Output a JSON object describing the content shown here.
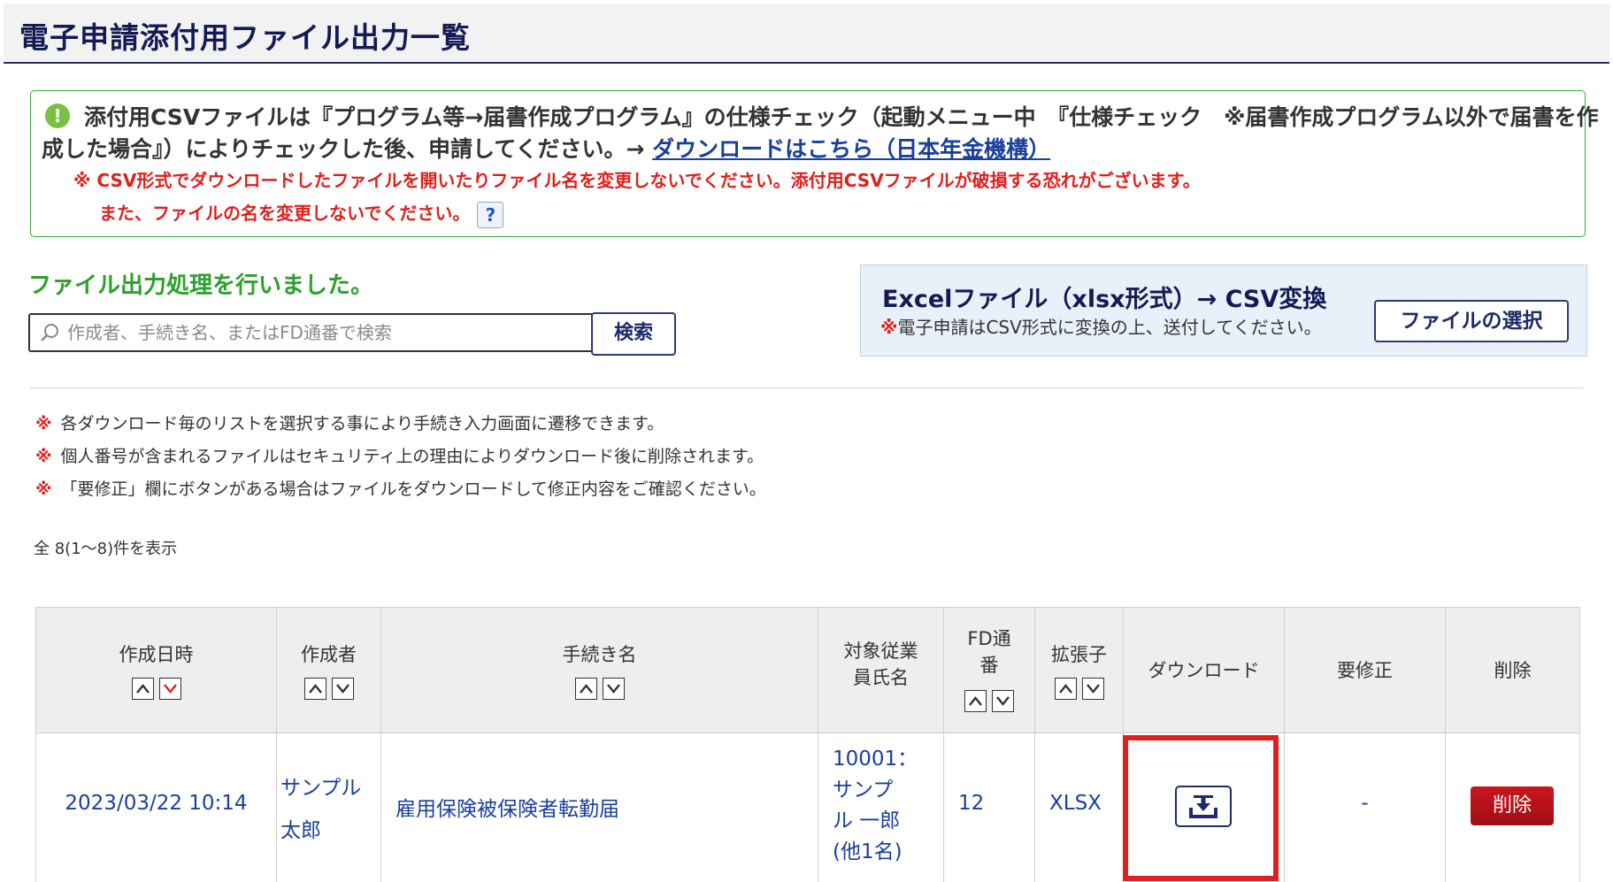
{
  "page": {
    "title": "電子申請添付用ファイル出力一覧"
  },
  "notice": {
    "icon": "exclamation-icon",
    "line1": "添付用CSVファイルは『プログラム等→届書作成プログラム』の仕様チェック（起動メニュー中　『仕様チェック　※届書作成プログラム以外で届書を作",
    "line2_prefix": "成した場合』）によりチェックした後、申請してください。→ ",
    "link": "ダウンロードはこちら（日本年金機構）",
    "warn1": "※ CSV形式でダウンロードしたファイルを開いたりファイル名を変更しないでください。添付用CSVファイルが破損する恐れがございます。",
    "warn2": "また、ファイルの名を変更しないでください。",
    "help": "?"
  },
  "process": {
    "message": "ファイル出力処理を行いました。"
  },
  "search": {
    "placeholder": "作成者、手続き名、またはFD通番で検索",
    "button": "検索"
  },
  "excel": {
    "title": "Excelファイル（xlsx形式）→ CSV変換",
    "note_mark": "※",
    "note": "電子申請はCSV形式に変換の上、送付してください。",
    "button": "ファイルの選択"
  },
  "notes": [
    {
      "mark": "※",
      "text": "各ダウンロード毎のリストを選択する事により手続き入力画面に遷移できます。"
    },
    {
      "mark": "※",
      "text": "個人番号が含まれるファイルはセキュリティ上の理由によりダウンロード後に削除されます。"
    },
    {
      "mark": "※",
      "text": "「要修正」欄にボタンがある場合はファイルをダウンロードして修正内容をご確認ください。"
    }
  ],
  "count": "全 8(1～8)件を表示",
  "table": {
    "headers": {
      "created": "作成日時",
      "creator": "作成者",
      "procedure": "手続き名",
      "employee_l1": "対象従業",
      "employee_l2": "員氏名",
      "fd_l1": "FD通",
      "fd_l2": "番",
      "ext": "拡張子",
      "download": "ダウンロード",
      "fix": "要修正",
      "delete": "削除"
    },
    "rows": [
      {
        "created": "2023/03/22 10:14",
        "creator_l1": "サンプル",
        "creator_l2": "太郎",
        "procedure": "雇用保険被保険者転勤届",
        "employee_l1": "10001：",
        "employee_l2": "サンプ",
        "employee_l3": "ル 一郎",
        "employee_l4": "(他1名)",
        "fd": "12",
        "ext": "XLSX",
        "fix": "-",
        "delete": "削除"
      }
    ]
  },
  "colors": {
    "accent_red": "#e0201c",
    "navy": "#141a55",
    "link_blue": "#1a3f9c",
    "green": "#2ea02e"
  }
}
